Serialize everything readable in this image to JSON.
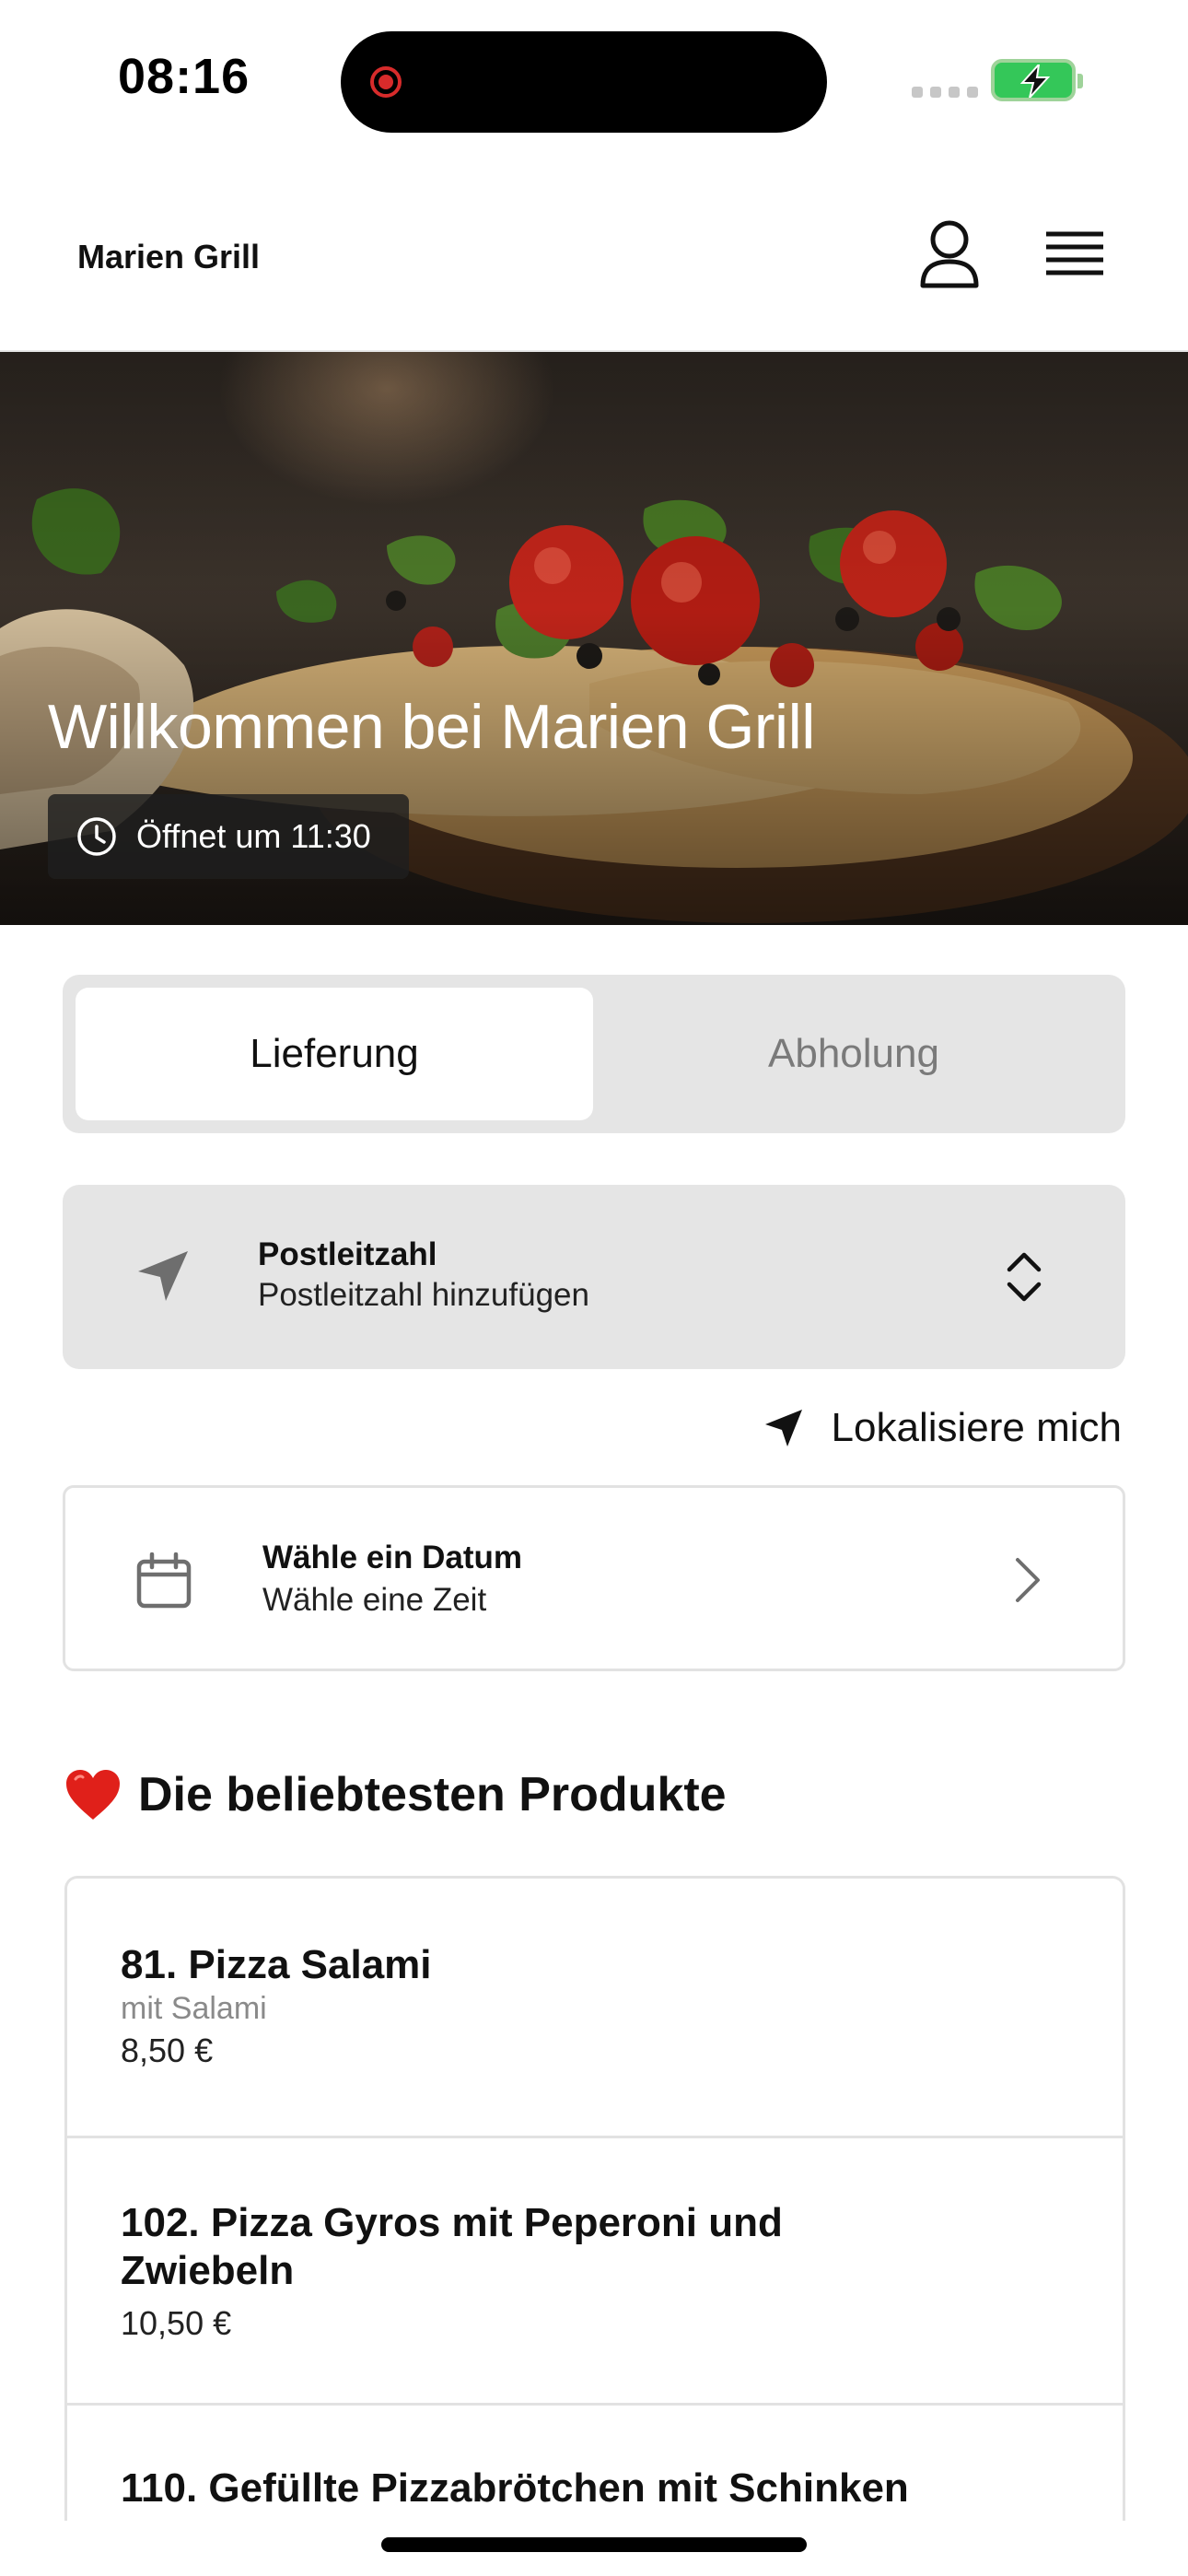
{
  "status_bar": {
    "time": "08:16"
  },
  "header": {
    "brand": "Marien Grill"
  },
  "hero": {
    "title": "Willkommen bei Marien Grill",
    "hours": "Öffnet um 11:30"
  },
  "order_mode": {
    "delivery_label": "Lieferung",
    "pickup_label": "Abholung",
    "selected": "Lieferung"
  },
  "postcode": {
    "title": "Postleitzahl",
    "value": "Postleitzahl hinzufügen"
  },
  "locate": {
    "label": "Lokalisiere mich"
  },
  "date_picker": {
    "title": "Wähle ein Datum",
    "value": "Wähle eine Zeit"
  },
  "popular": {
    "title": "Die beliebtesten Produkte",
    "items": [
      {
        "name": "81. Pizza Salami",
        "description": "mit Salami",
        "price": "8,50 €"
      },
      {
        "name": "102. Pizza Gyros mit Peperoni und Zwiebeln",
        "price": "10,50 €"
      },
      {
        "name": "110. Gefüllte Pizzabrötchen mit Schinken"
      }
    ]
  },
  "colors": {
    "accent": "#111111",
    "field_background": "#e5e5e5",
    "battery": "#34c759",
    "record": "#d72b2b"
  },
  "icons": [
    "record-icon",
    "battery-icon",
    "profile-icon",
    "menu-icon",
    "clock-icon",
    "location-arrow-icon",
    "up-down-chevron-icon",
    "calendar-icon",
    "chevron-right-icon",
    "heart-icon"
  ]
}
